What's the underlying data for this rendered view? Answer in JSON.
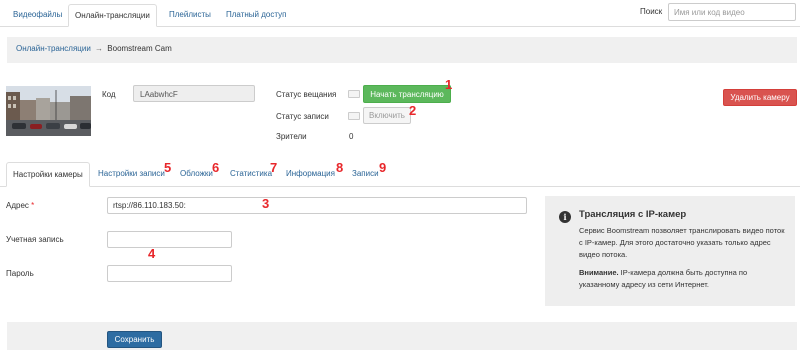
{
  "nav": {
    "tabs": [
      {
        "label": "Видеофайлы"
      },
      {
        "label": "Онлайн-трансляции"
      },
      {
        "label": "Плейлисты"
      },
      {
        "label": "Платный доступ"
      }
    ],
    "active_tab": "Онлайн-трансляции",
    "search_label": "Поиск",
    "search_placeholder": "Имя или код видео"
  },
  "breadcrumb": {
    "parent": "Онлайн-трансляции",
    "separator": "→",
    "current": "Boomstream Cam"
  },
  "camera": {
    "code_label": "Код",
    "code_value": "LAabwhcF",
    "broadcast_status_label": "Статус вещания",
    "start_button": "Начать трансляцию",
    "record_status_label": "Статус записи",
    "enable_button": "Включить",
    "viewers_label": "Зрители",
    "viewers_count": "0",
    "delete_button": "Удалить камеру"
  },
  "tabs": [
    {
      "label": "Настройки камеры"
    },
    {
      "label": "Настройки записи"
    },
    {
      "label": "Обложки"
    },
    {
      "label": "Статистика"
    },
    {
      "label": "Информация"
    },
    {
      "label": "Записи"
    }
  ],
  "active_subtab": "Настройки камеры",
  "form": {
    "address_label": "Адрес",
    "required_mark": "*",
    "address_value": "rtsp://86.110.183.50:",
    "account_label": "Учетная запись",
    "account_value": "",
    "password_label": "Пароль",
    "password_value": "",
    "save_button": "Сохранить"
  },
  "info": {
    "title": "Трансляция с IP-камер",
    "text": "Сервис Boomstream позволяет транслировать видео поток с IP-камер. Для этого достаточно указать только адрес видео потока.",
    "warning_bold": "Внимание.",
    "warning_text": " IP-камера должна быть доступна по указанному адресу из сети Интернет."
  },
  "annotations": [
    "1",
    "2",
    "3",
    "4",
    "5",
    "6",
    "7",
    "8",
    "9"
  ],
  "colors": {
    "link": "#2a6496",
    "start_button": "#5cb85c",
    "delete_button": "#d9534f",
    "save_button": "#2d6ca2",
    "annotation": "#e8272b"
  },
  "icons": {
    "info": "info-circle-icon"
  }
}
